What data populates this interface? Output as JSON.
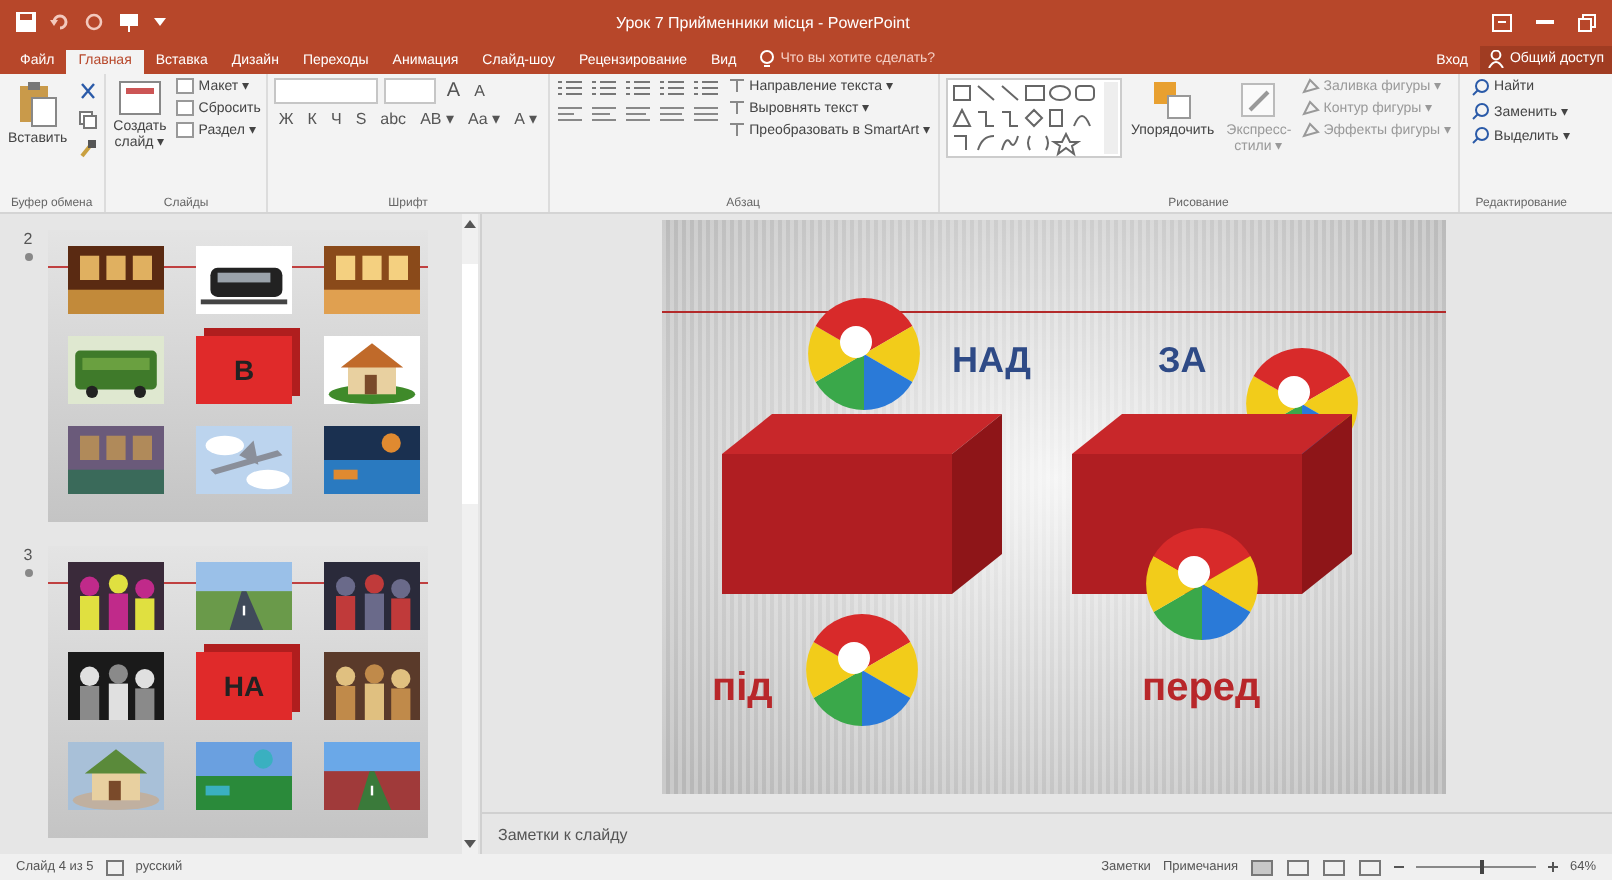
{
  "window": {
    "title": "Урок 7 Прийменники місця - PowerPoint"
  },
  "tabs": [
    {
      "label": "Файл",
      "selected": false
    },
    {
      "label": "Главная",
      "selected": true
    },
    {
      "label": "Вставка",
      "selected": false
    },
    {
      "label": "Дизайн",
      "selected": false
    },
    {
      "label": "Переходы",
      "selected": false
    },
    {
      "label": "Анимация",
      "selected": false
    },
    {
      "label": "Слайд-шоу",
      "selected": false
    },
    {
      "label": "Рецензирование",
      "selected": false
    },
    {
      "label": "Вид",
      "selected": false
    }
  ],
  "tell_me": {
    "placeholder": "Что вы хотите сделать?"
  },
  "sign_in": "Вход",
  "share": "Общий доступ",
  "ribbon_groups": [
    {
      "kind": "clipboard",
      "name": "Буфер обмена",
      "paste": "Вставить"
    },
    {
      "kind": "slides",
      "name": "Слайды",
      "new_slide": [
        "Создать",
        "слайд ▾"
      ],
      "buttons": [
        "Макет ▾",
        "Сбросить",
        "Раздел ▾"
      ]
    },
    {
      "kind": "font",
      "name": "Шрифт",
      "grow": [
        "A",
        "A"
      ],
      "format_buttons": [
        "Ж",
        "К",
        "Ч",
        "S",
        "abc",
        "АВ ▾",
        "Аа ▾",
        "А ▾"
      ]
    },
    {
      "kind": "paragraph",
      "name": "Абзац",
      "buttons": [
        "Направление текста ▾",
        "Выровнять текст ▾",
        "Преобразовать в SmartArt ▾"
      ]
    },
    {
      "kind": "drawing",
      "name": "Рисование",
      "arrange": "Упорядочить",
      "styles": [
        "Экспресс-",
        "стили ▾"
      ],
      "buttons": [
        "Заливка фигуры ▾",
        "Контур фигуры ▾",
        "Эффекты фигуры ▾"
      ]
    },
    {
      "kind": "editing",
      "name": "Редактирование",
      "buttons": [
        "Найти",
        "Заменить ▾",
        "Выделить ▾"
      ]
    }
  ],
  "thumbnails": [
    {
      "number": "2",
      "cells": [
        {
          "kind": "picture"
        },
        {
          "kind": "picture"
        },
        {
          "kind": "picture"
        },
        {
          "kind": "picture"
        },
        {
          "kind": "box",
          "label": "В"
        },
        {
          "kind": "picture"
        },
        {
          "kind": "picture"
        },
        {
          "kind": "picture"
        },
        {
          "kind": "picture"
        }
      ]
    },
    {
      "number": "3",
      "cells": [
        {
          "kind": "picture"
        },
        {
          "kind": "picture"
        },
        {
          "kind": "picture"
        },
        {
          "kind": "picture"
        },
        {
          "kind": "box",
          "label": "НА"
        },
        {
          "kind": "picture"
        },
        {
          "kind": "picture"
        },
        {
          "kind": "picture"
        },
        {
          "kind": "picture"
        }
      ]
    }
  ],
  "slide": {
    "labels": [
      {
        "text": "НАД",
        "color": "#2e4a86"
      },
      {
        "text": "ЗА",
        "color": "#2e4a86"
      },
      {
        "text": "під",
        "color": "#b8272a"
      },
      {
        "text": "перед",
        "color": "#b8272a"
      }
    ]
  },
  "notes": {
    "placeholder": "Заметки к слайду"
  },
  "status_bar": {
    "slide": "Слайд 4 из 5",
    "language": "русский",
    "notes": "Заметки",
    "comments": "Примечания",
    "zoom": "64%",
    "zoom_slider": {
      "level": 0.55
    }
  }
}
